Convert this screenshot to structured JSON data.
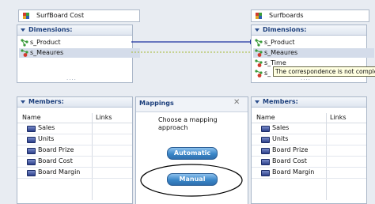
{
  "source": {
    "cube_title": "SurfBoard Cost",
    "dimensions_header": "Dimensions:",
    "dimensions": [
      "s_Product",
      "s_Meaures"
    ],
    "members_header": "Members:",
    "columns": [
      "Name",
      "Links"
    ],
    "members": [
      "Sales",
      "Units",
      "Board Prize",
      "Board Cost",
      "Board Margin"
    ]
  },
  "target": {
    "cube_title": "Surfboards",
    "dimensions_header": "Dimensions:",
    "dimensions": [
      "s_Product",
      "s_Meaures",
      "s_Time",
      "s_"
    ],
    "members_header": "Members:",
    "columns": [
      "Name",
      "Links"
    ],
    "members": [
      "Sales",
      "Units",
      "Board Prize",
      "Board Cost",
      "Board Margin"
    ]
  },
  "mappings": {
    "title": "Mappings",
    "close_glyph": "✕",
    "prompt": "Choose a mapping approach",
    "automatic_label": "Automatic",
    "manual_label": "Manual"
  },
  "tooltip": "The correspondence is not comple",
  "scroll_dots": "....",
  "colors": {
    "mapping_line": "#1c2fa0",
    "suggested_line": "#a3b832",
    "header_text": "#1c3f7c",
    "button": "#3a86c8"
  },
  "icons": {
    "cube": "cube-icon",
    "dimension": "dimension-tree-icon",
    "member": "measure-icon",
    "collapse": "triangle-down-icon",
    "close": "close-icon"
  }
}
